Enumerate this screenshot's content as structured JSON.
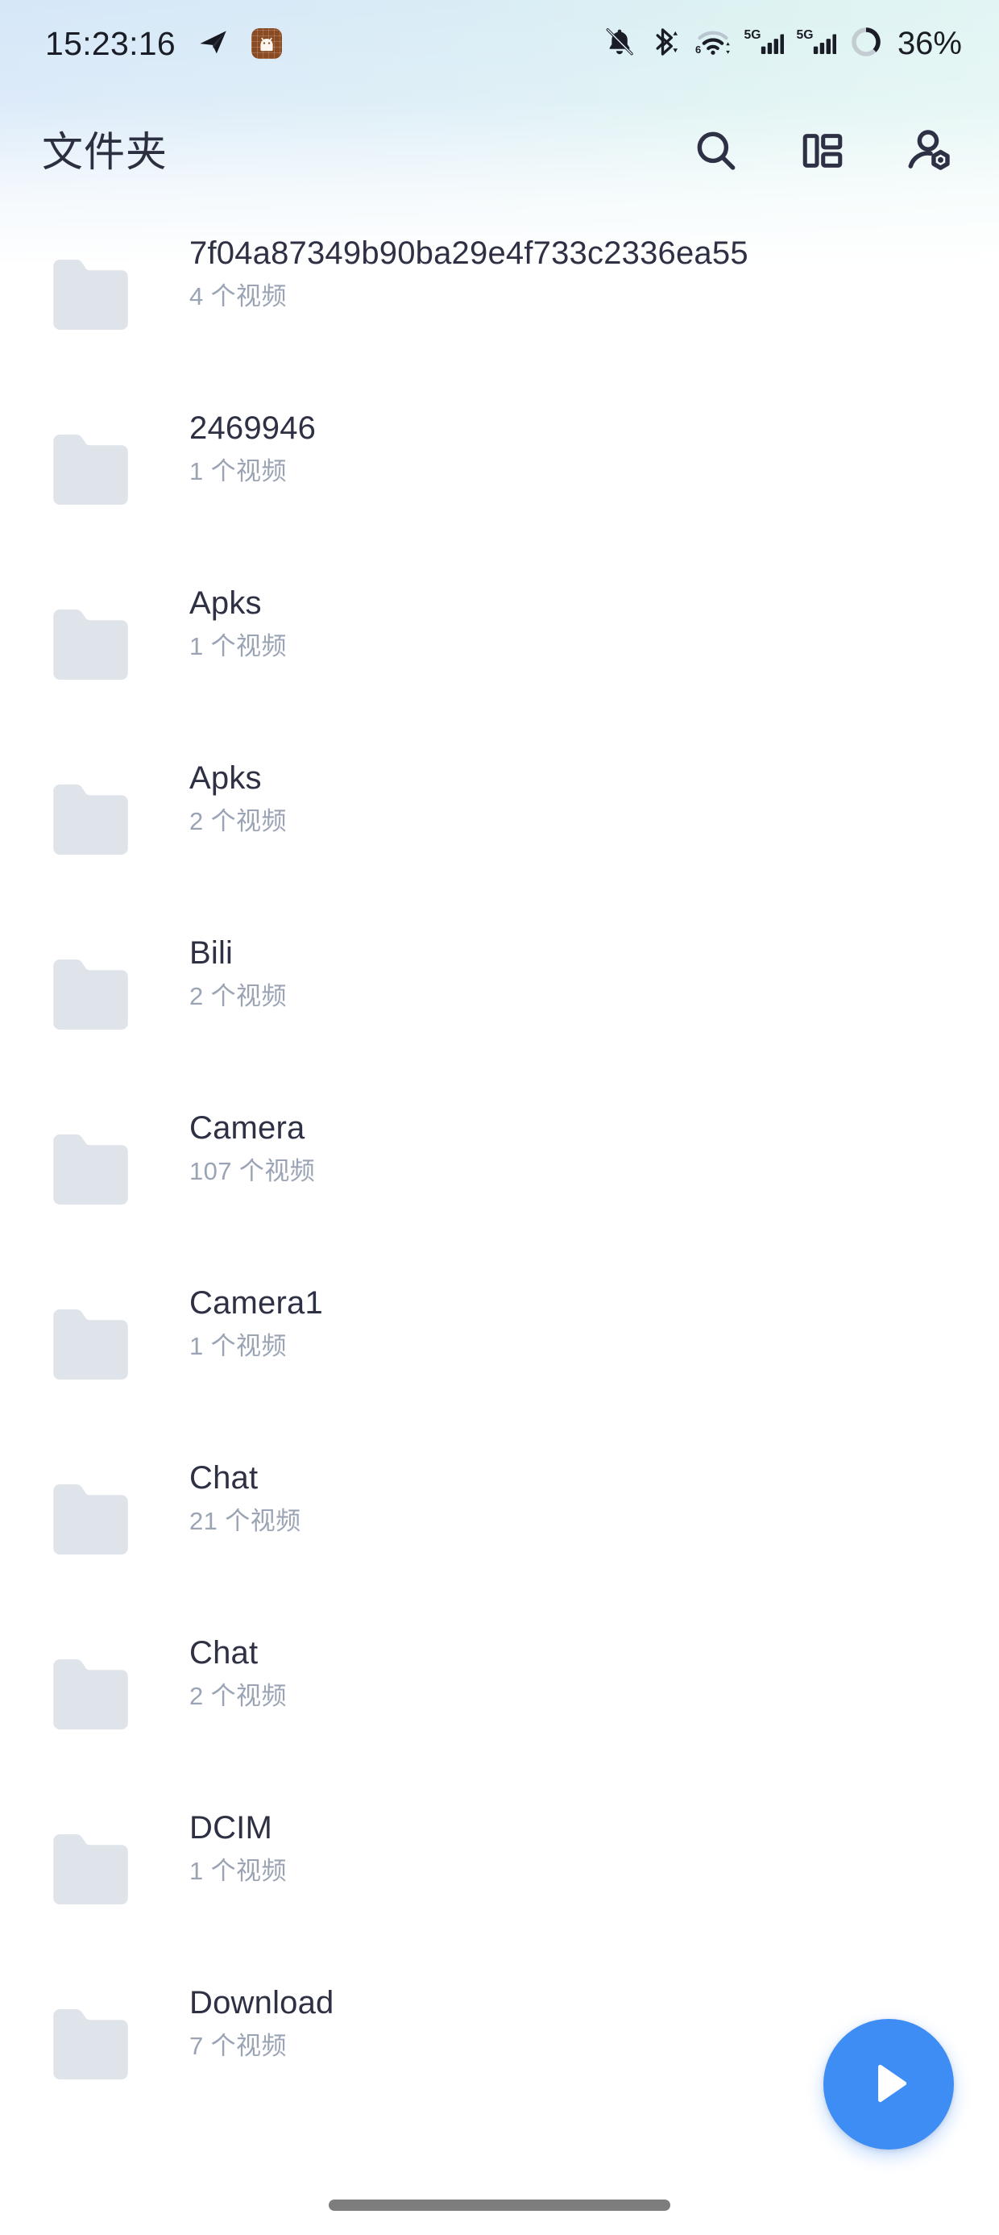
{
  "status_bar": {
    "clock": "15:23:16",
    "battery_percent": "36%",
    "left_icons": [
      "telegram-plane-icon",
      "android-app-icon"
    ],
    "right_icons": [
      "notifications-muted-icon",
      "bluetooth-transfer-icon",
      "wifi-6-icon",
      "signal-5g-sim1-icon",
      "signal-5g-sim2-icon",
      "battery-ring-icon"
    ]
  },
  "app_bar": {
    "title": "文件夹",
    "actions": [
      {
        "name": "search-icon",
        "label": "搜索"
      },
      {
        "name": "view-layout-icon",
        "label": "布局"
      },
      {
        "name": "account-settings-icon",
        "label": "账号"
      }
    ]
  },
  "folders": [
    {
      "name": "7f04a87349b90ba29e4f733c2336ea55",
      "count": "4 个视频"
    },
    {
      "name": "2469946",
      "count": "1 个视频"
    },
    {
      "name": "Apks",
      "count": "1 个视频"
    },
    {
      "name": "Apks",
      "count": "2 个视频"
    },
    {
      "name": "Bili",
      "count": "2 个视频"
    },
    {
      "name": "Camera",
      "count": "107 个视频"
    },
    {
      "name": "Camera1",
      "count": "1 个视频"
    },
    {
      "name": "Chat",
      "count": "21 个视频"
    },
    {
      "name": "Chat",
      "count": "2 个视频"
    },
    {
      "name": "DCIM",
      "count": "1 个视频"
    },
    {
      "name": "Download",
      "count": "7 个视频"
    }
  ],
  "fab": {
    "name": "play-button",
    "icon": "play-triangle-icon",
    "color": "#3d8df5"
  },
  "colors": {
    "title_text": "#2e3044",
    "subtitle_text": "#9ba4b5",
    "folder_icon": "#dfe3ea",
    "accent": "#3d8df5",
    "gradient_start": "#d6e7f8",
    "gradient_end": "#e3f6f4"
  },
  "navigation": {
    "gesture_bar": "home-gesture-bar"
  }
}
